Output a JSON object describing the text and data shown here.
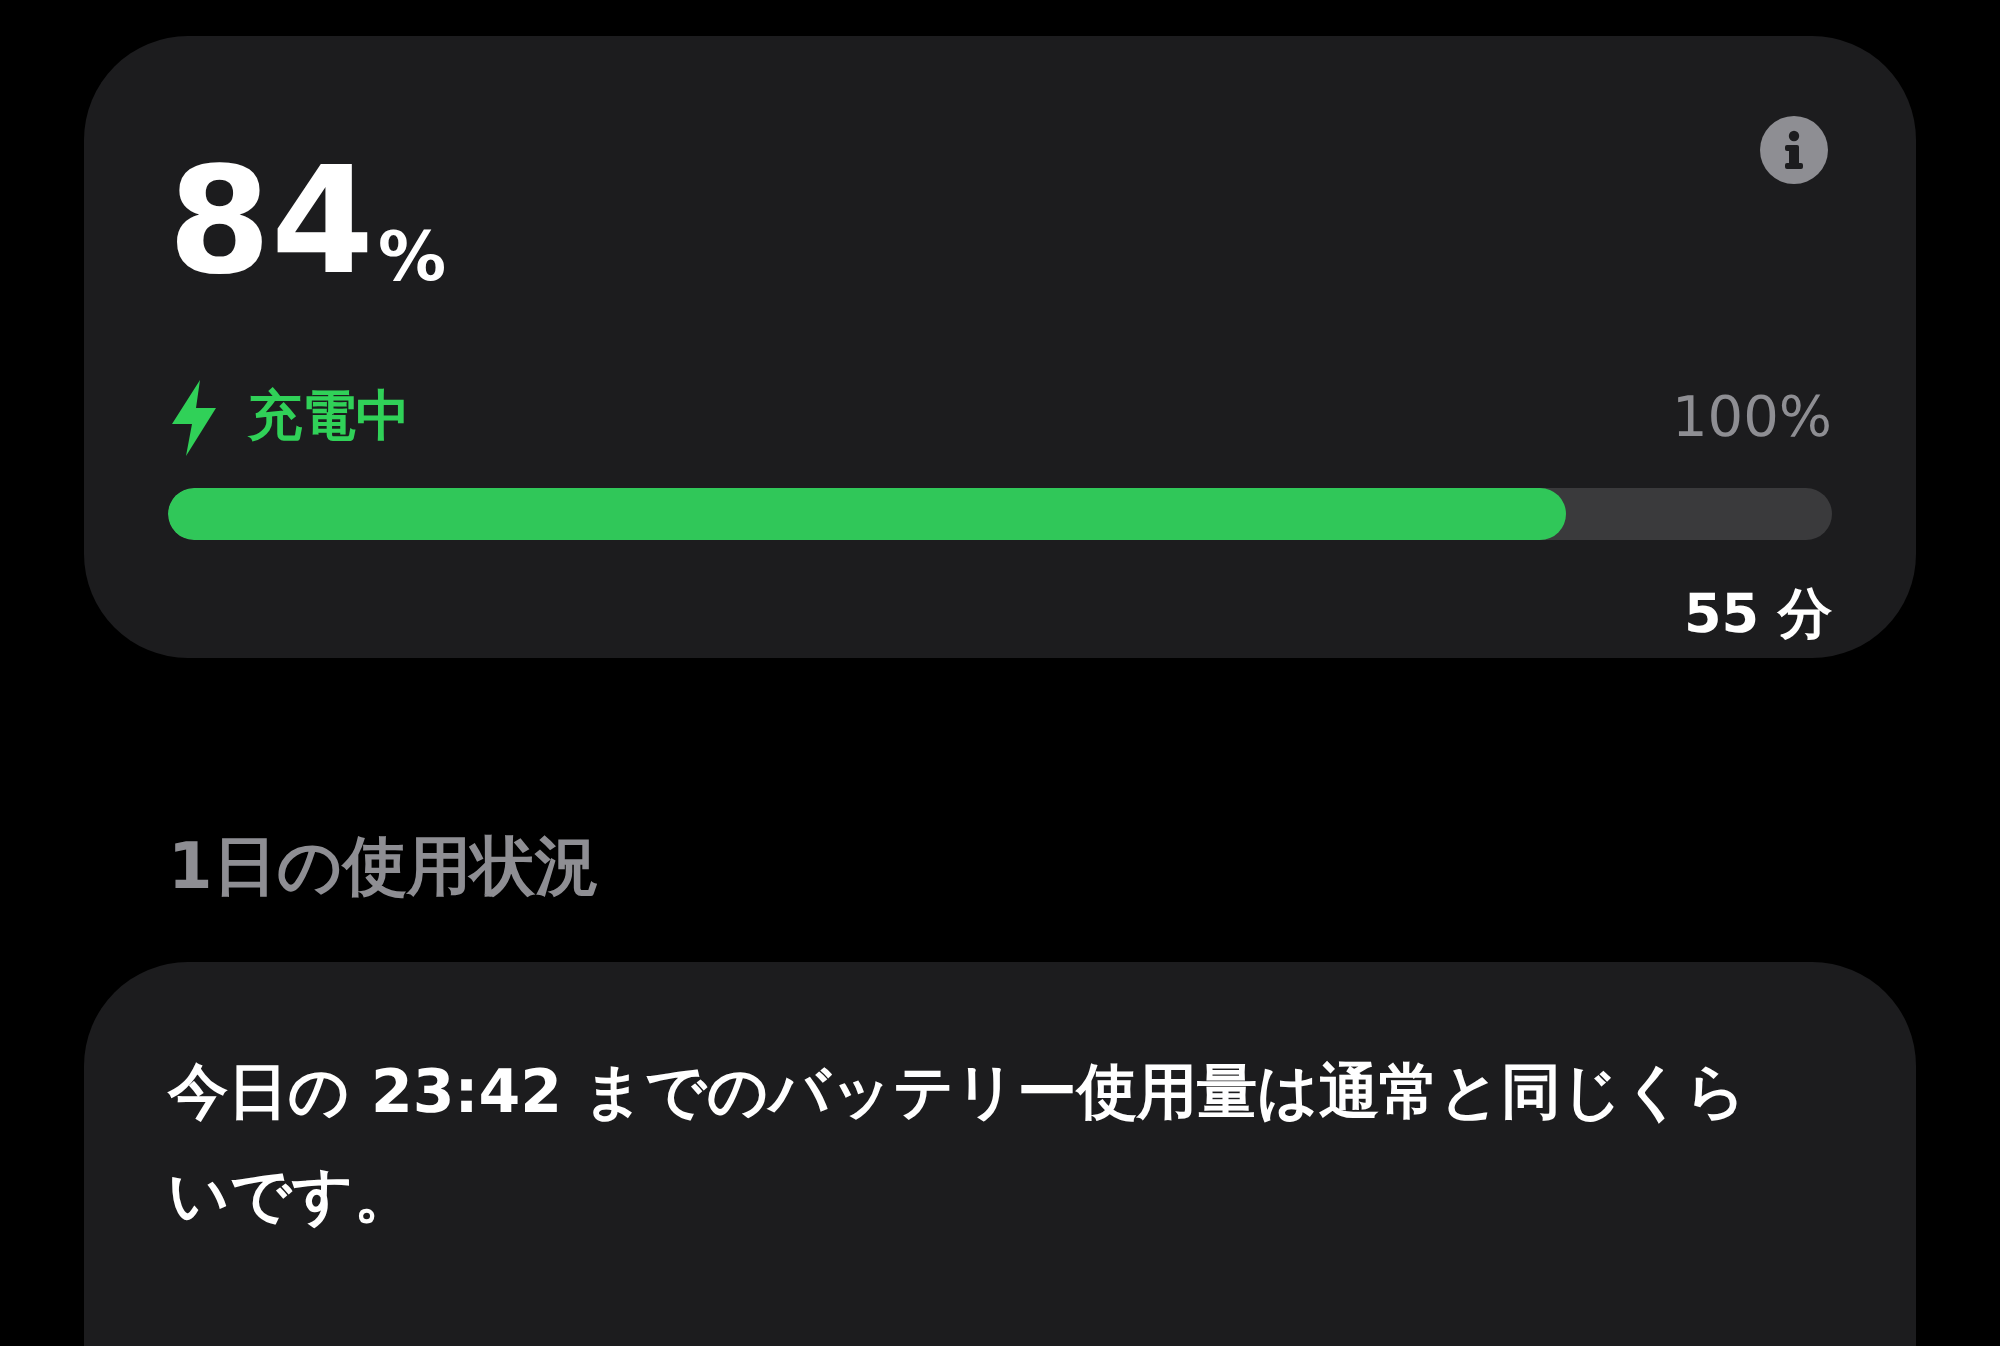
{
  "battery": {
    "percent": "84",
    "unit": "%",
    "charging": true,
    "status": "充電中",
    "limit": "100%",
    "level": 0.84,
    "time_to_full": "55 分"
  },
  "section_title": "1日の使用状況",
  "usage_summary": "今日の 23:42 までのバッテリー使用量は通常と同じくらいです。"
}
